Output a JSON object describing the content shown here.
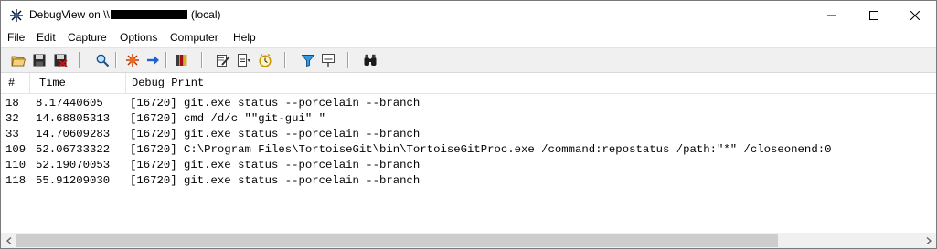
{
  "window": {
    "title_prefix": "DebugView on \\\\",
    "title_suffix": "(local)"
  },
  "menu": [
    {
      "label": "File"
    },
    {
      "label": "Edit"
    },
    {
      "label": "Capture"
    },
    {
      "label": "Options"
    },
    {
      "label": "Computer"
    },
    {
      "label": "Help"
    }
  ],
  "toolbar": {
    "icons": [
      "open-icon",
      "save-icon",
      "clear-display-icon",
      "find-icon",
      "capture-icon",
      "autoscroll-icon",
      "history-depth-icon",
      "highlight-icon",
      "filter-icon",
      "clock-icon",
      "capture-filter-icon",
      "bookmark-icon",
      "find-binoculars-icon"
    ]
  },
  "columns": {
    "number": "#",
    "time": "Time",
    "debug_print": "Debug Print"
  },
  "rows": [
    {
      "num": "18",
      "time": "8.17440605",
      "text": "[16720] git.exe status --porcelain --branch"
    },
    {
      "num": "32",
      "time": "14.68805313",
      "text": "[16720] cmd /d/c \"\"git-gui\" \""
    },
    {
      "num": "33",
      "time": "14.70609283",
      "text": "[16720] git.exe status --porcelain --branch"
    },
    {
      "num": "109",
      "time": "52.06733322",
      "text": "[16720] C:\\Program Files\\TortoiseGit\\bin\\TortoiseGitProc.exe /command:repostatus /path:\"*\" /closeonend:0"
    },
    {
      "num": "110",
      "time": "52.19070053",
      "text": "[16720] git.exe status --porcelain --branch"
    },
    {
      "num": "118",
      "time": "55.91209030",
      "text": "[16720] git.exe status --porcelain --branch"
    }
  ],
  "colors": {
    "toolbar_bg": "#f0f0f0",
    "scrollbar_thumb": "#cdcdcd"
  }
}
